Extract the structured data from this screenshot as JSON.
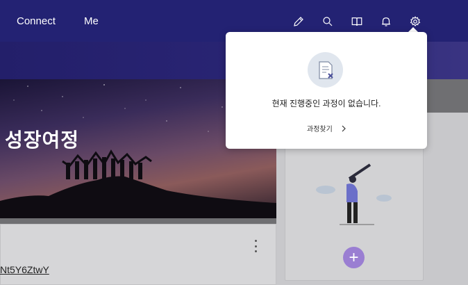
{
  "nav": {
    "items": [
      "Connect",
      "Me"
    ],
    "icons": [
      "pencil-icon",
      "search-icon",
      "book-icon",
      "bell-icon",
      "gear-icon"
    ]
  },
  "hero": {
    "title": "성장여정"
  },
  "popup": {
    "message": "현재 진행중인 과정이 없습니다.",
    "link_label": "과정찾기"
  },
  "card": {
    "code_text": "Nt5Y6ZtwY"
  },
  "right_card": {
    "plus_label": "+"
  },
  "colors": {
    "nav": "#232273",
    "accent": "#9a7ed2",
    "popup": "#ffffff"
  }
}
